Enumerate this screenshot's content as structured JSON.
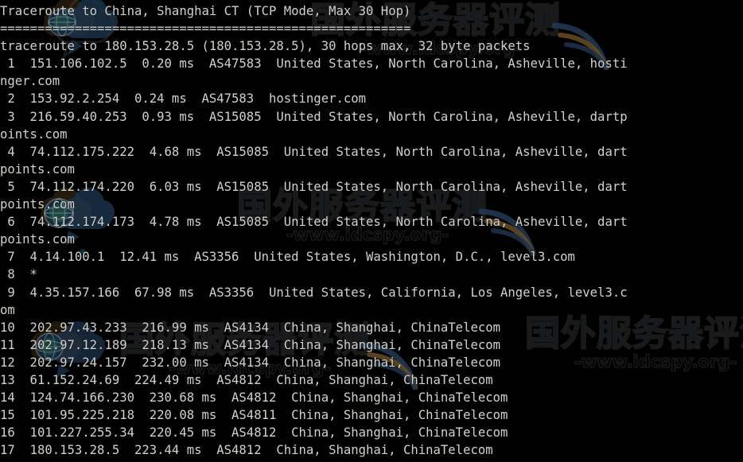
{
  "terminal": {
    "background_color": "#000000",
    "text_color": "#d4d1cb",
    "title_line": "Traceroute to China, Shanghai CT (TCP Mode, Max 30 Hop)",
    "separator_line": "=======================================================",
    "command_line": "traceroute to 180.153.28.5 (180.153.28.5), 30 hops max, 32 byte packets",
    "lines": [
      " 1  151.106.102.5  0.20 ms  AS47583  United States, North Carolina, Asheville, hostinger.com",
      " 2  153.92.2.254  0.24 ms  AS47583  hostinger.com",
      " 3  216.59.40.253  0.93 ms  AS15085  United States, North Carolina, Asheville, dartpoints.com",
      " 4  74.112.175.222  4.68 ms  AS15085  United States, North Carolina, Asheville, dartpoints.com",
      " 5  74.112.174.220  6.03 ms  AS15085  United States, North Carolina, Asheville, dartpoints.com",
      " 6  74.112.174.173  4.78 ms  AS15085  United States, North Carolina, Asheville, dartpoints.com",
      " 7  4.14.100.1  12.41 ms  AS3356  United States, Washington, D.C., level3.com",
      " 8  *",
      " 9  4.35.157.166  67.98 ms  AS3356  United States, California, Los Angeles, level3.com",
      "10  202.97.43.233  216.99 ms  AS4134  China, Shanghai, ChinaTelecom",
      "11  202.97.12.189  218.13 ms  AS4134  China, Shanghai, ChinaTelecom",
      "12  202.97.24.157  232.00 ms  AS4134  China, Shanghai, ChinaTelecom",
      "13  61.152.24.69  224.49 ms  AS4812  China, Shanghai, ChinaTelecom",
      "14  124.74.166.230  230.68 ms  AS4812  China, Shanghai, ChinaTelecom",
      "15  101.95.225.218  220.08 ms  AS4811  China, Shanghai, ChinaTelecom",
      "16  101.227.255.34  220.45 ms  AS4812  China, Shanghai, ChinaTelecom",
      "17  180.153.28.5  223.44 ms  AS4812  China, Shanghai, ChinaTelecom"
    ],
    "hops": [
      {
        "hop": "1",
        "ip": "151.106.102.5",
        "latency": "0.20 ms",
        "asn": "AS47583",
        "location": "United States, North Carolina, Asheville, hostinger.com"
      },
      {
        "hop": "2",
        "ip": "153.92.2.254",
        "latency": "0.24 ms",
        "asn": "AS47583",
        "location": "hostinger.com"
      },
      {
        "hop": "3",
        "ip": "216.59.40.253",
        "latency": "0.93 ms",
        "asn": "AS15085",
        "location": "United States, North Carolina, Asheville, dartpoints.com"
      },
      {
        "hop": "4",
        "ip": "74.112.175.222",
        "latency": "4.68 ms",
        "asn": "AS15085",
        "location": "United States, North Carolina, Asheville, dartpoints.com"
      },
      {
        "hop": "5",
        "ip": "74.112.174.220",
        "latency": "6.03 ms",
        "asn": "AS15085",
        "location": "United States, North Carolina, Asheville, dartpoints.com"
      },
      {
        "hop": "6",
        "ip": "74.112.174.173",
        "latency": "4.78 ms",
        "asn": "AS15085",
        "location": "United States, North Carolina, Asheville, dartpoints.com"
      },
      {
        "hop": "7",
        "ip": "4.14.100.1",
        "latency": "12.41 ms",
        "asn": "AS3356",
        "location": "United States, Washington, D.C., level3.com"
      },
      {
        "hop": "8",
        "ip": "*",
        "latency": "",
        "asn": "",
        "location": ""
      },
      {
        "hop": "9",
        "ip": "4.35.157.166",
        "latency": "67.98 ms",
        "asn": "AS3356",
        "location": "United States, California, Los Angeles, level3.com"
      },
      {
        "hop": "10",
        "ip": "202.97.43.233",
        "latency": "216.99 ms",
        "asn": "AS4134",
        "location": "China, Shanghai, ChinaTelecom"
      },
      {
        "hop": "11",
        "ip": "202.97.12.189",
        "latency": "218.13 ms",
        "asn": "AS4134",
        "location": "China, Shanghai, ChinaTelecom"
      },
      {
        "hop": "12",
        "ip": "202.97.24.157",
        "latency": "232.00 ms",
        "asn": "AS4134",
        "location": "China, Shanghai, ChinaTelecom"
      },
      {
        "hop": "13",
        "ip": "61.152.24.69",
        "latency": "224.49 ms",
        "asn": "AS4812",
        "location": "China, Shanghai, ChinaTelecom"
      },
      {
        "hop": "14",
        "ip": "124.74.166.230",
        "latency": "230.68 ms",
        "asn": "AS4812",
        "location": "China, Shanghai, ChinaTelecom"
      },
      {
        "hop": "15",
        "ip": "101.95.225.218",
        "latency": "220.08 ms",
        "asn": "AS4811",
        "location": "China, Shanghai, ChinaTelecom"
      },
      {
        "hop": "16",
        "ip": "101.227.255.34",
        "latency": "220.45 ms",
        "asn": "AS4812",
        "location": "China, Shanghai, ChinaTelecom"
      },
      {
        "hop": "17",
        "ip": "180.153.28.5",
        "latency": "223.44 ms",
        "asn": "AS4812",
        "location": "China, Shanghai, ChinaTelecom"
      }
    ]
  },
  "watermark": {
    "chinese_text": "国外服务器评测",
    "url_text": "-www.idcspy.org-",
    "stroke_color": "#96a0af"
  }
}
